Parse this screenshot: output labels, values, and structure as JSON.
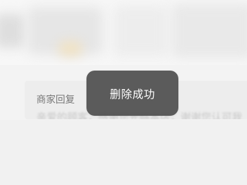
{
  "reply_card": {
    "title": "商家回复",
    "text": "亲爱的顾客，感谢您光临本店，谢谢您认可我"
  },
  "toast": {
    "message": "删除成功"
  },
  "colors": {
    "toast_bg": "#4e4e4e",
    "card_bg": "#ededed",
    "page_bg": "#f3f3f3"
  }
}
